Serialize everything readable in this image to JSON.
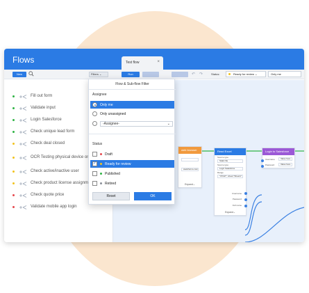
{
  "app": {
    "title": "Flows"
  },
  "toolbar": {
    "new_label": "New",
    "filters_label": "Filters"
  },
  "flows": [
    {
      "label": "Fill out form",
      "color": "#2fb344"
    },
    {
      "label": "Validate input",
      "color": "#2fb344"
    },
    {
      "label": "Login Salesforce",
      "color": "#2fb344"
    },
    {
      "label": "Check unique lead form",
      "color": "#2fb344"
    },
    {
      "label": "Check deal closed",
      "color": "#f2c21b"
    },
    {
      "label": "OCR Testing physical device on browserstack",
      "color": "#f2c21b"
    },
    {
      "label": "Check active/inactive user",
      "color": "#f2c21b"
    },
    {
      "label": "Check product license assignment",
      "color": "#f2c21b"
    },
    {
      "label": "Check quote price",
      "color": "#e5484d"
    },
    {
      "label": "Validate mobile app login",
      "color": "#e5484d"
    }
  ],
  "editor": {
    "tab_label": "Test flow",
    "run_label": "Run",
    "status_label": "Status:",
    "status_value": "Ready for review",
    "assignee_value": "Only me"
  },
  "filter": {
    "title": "Flow & Sub-flow Filter",
    "assignee_heading": "Assignee",
    "assignee_options": [
      "Only me",
      "Only unassigned"
    ],
    "assignee_select": "-Assignee-",
    "status_heading": "Status",
    "statuses": [
      {
        "label": "Draft",
        "color": "#e5484d",
        "checked": false
      },
      {
        "label": "Ready for review",
        "color": "#f2c21b",
        "checked": true
      },
      {
        "label": "Published",
        "color": "#2fb344",
        "checked": false
      },
      {
        "label": "Retired",
        "color": "#8a8f98",
        "checked": false
      }
    ],
    "reset_label": "Reset",
    "ok_label": "OK"
  },
  "nodes": {
    "web": {
      "title": "web browser",
      "color": "#f19a3e",
      "field_value": "staticforms.com",
      "footer": "Expand"
    },
    "excel": {
      "title": "Read Excel",
      "color": "#2b7be4",
      "source_label": "Source type",
      "source_value": "Static file",
      "source2_label": "Source type",
      "source2_value": "Login Salesforce",
      "range_label": "Range",
      "range_value": "\"C5:E7\"; sheet:\"Sheet1\"",
      "outputs": [
        "Username",
        "Password",
        "Full name"
      ],
      "footer": "Expand"
    },
    "salesforce": {
      "title": "Login to Salesforce",
      "color": "#9b59d6",
      "inputs": [
        "Username",
        "Password"
      ],
      "placeholder": "Value here"
    }
  }
}
